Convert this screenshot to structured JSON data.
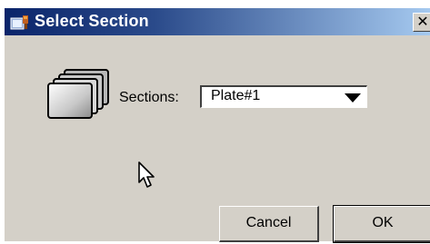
{
  "window": {
    "title": "Select Section",
    "close_glyph": "✕"
  },
  "form": {
    "sections_label": "Sections:",
    "sections_selected": "Plate#1"
  },
  "buttons": {
    "cancel_label": "Cancel",
    "ok_label": "OK"
  },
  "icons": {
    "title_icon": "app-icon",
    "sections_icon": "stacked-plates-icon",
    "dropdown_icon": "triangle-down-icon",
    "cursor": "mouse-pointer"
  },
  "colors": {
    "title_gradient_start": "#0a246a",
    "title_gradient_end": "#a6caf0",
    "dialog_face": "#d4d0c8"
  }
}
